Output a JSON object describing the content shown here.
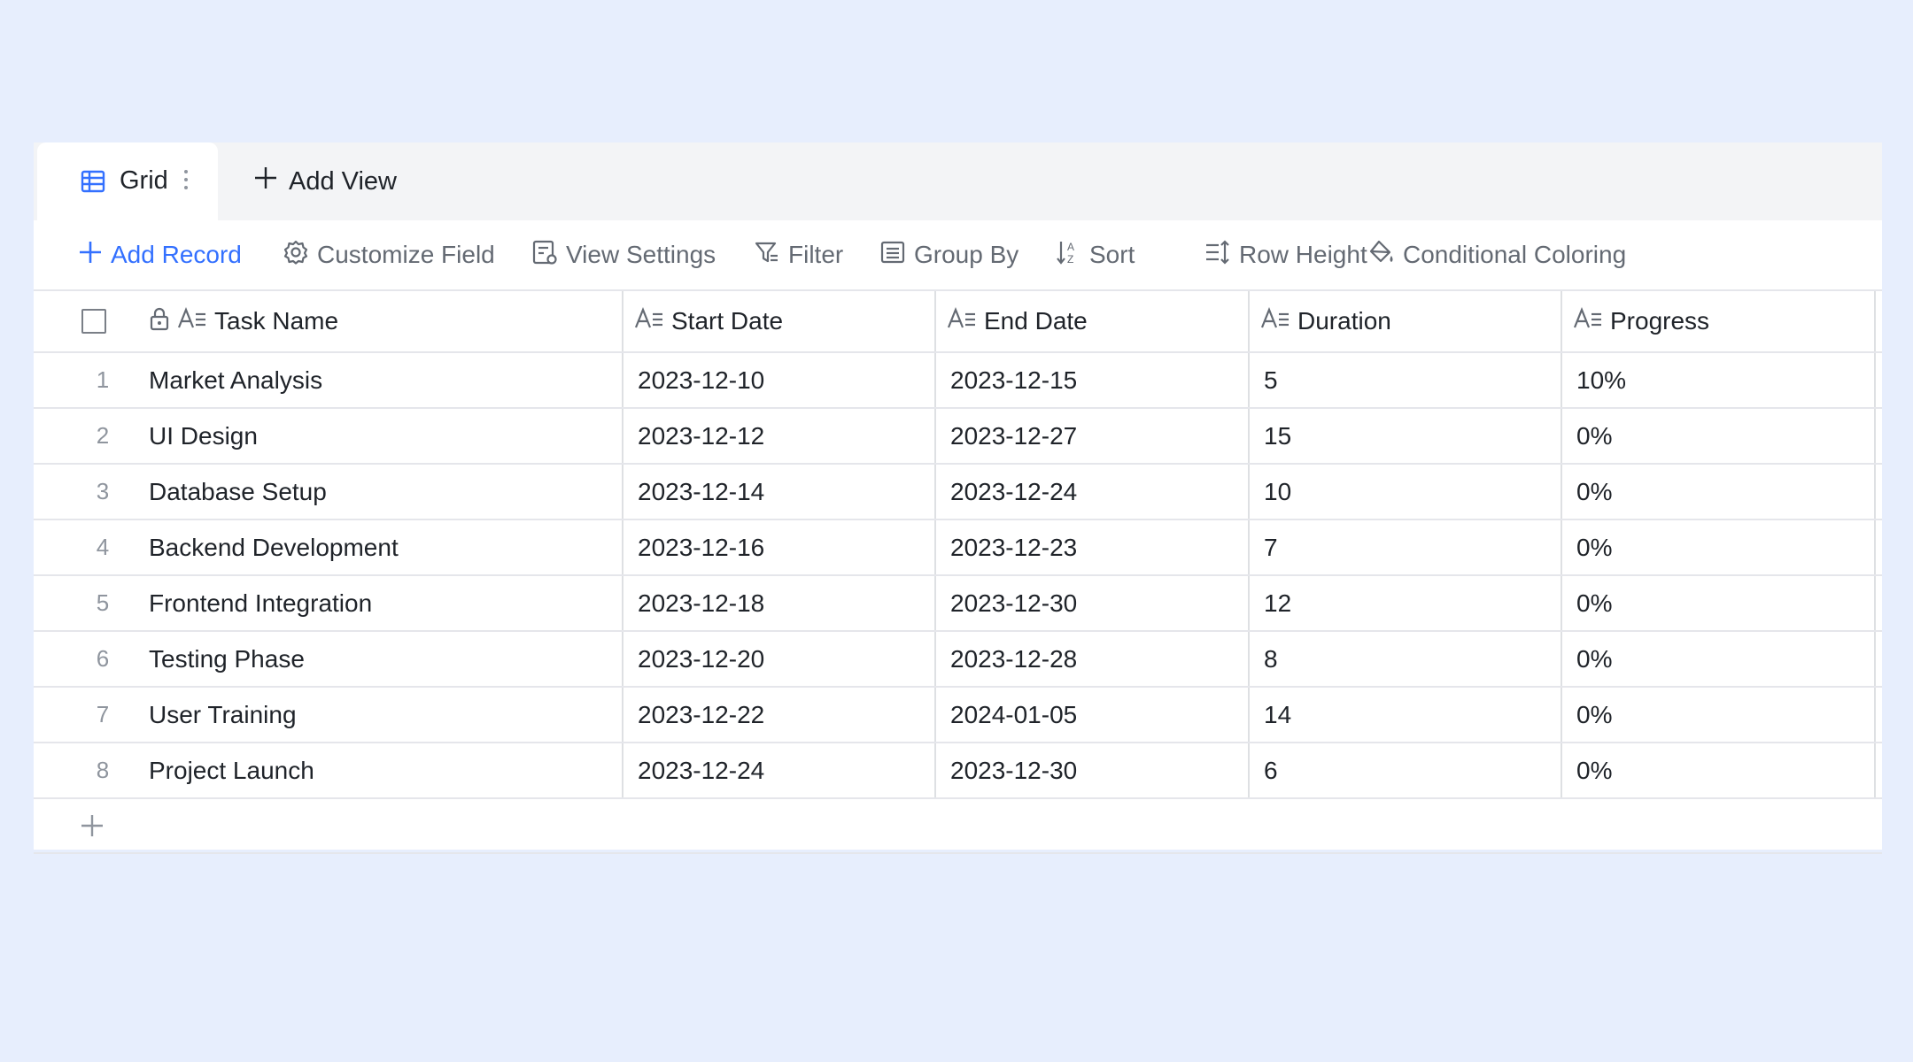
{
  "tabs": {
    "active_label": "Grid",
    "add_view_label": "Add View"
  },
  "toolbar": {
    "add_record": "Add Record",
    "customize_field": "Customize Field",
    "view_settings": "View Settings",
    "filter": "Filter",
    "group_by": "Group By",
    "sort": "Sort",
    "row_height": "Row Height",
    "conditional_coloring": "Conditional Coloring"
  },
  "table": {
    "columns": [
      "Task Name",
      "Start Date",
      "End Date",
      "Duration",
      "Progress"
    ],
    "rows": [
      {
        "num": "1",
        "task": "Market Analysis",
        "start": "2023-12-10",
        "end": "2023-12-15",
        "duration": "5",
        "progress": "10%"
      },
      {
        "num": "2",
        "task": "UI Design",
        "start": "2023-12-12",
        "end": "2023-12-27",
        "duration": "15",
        "progress": "0%"
      },
      {
        "num": "3",
        "task": "Database Setup",
        "start": "2023-12-14",
        "end": "2023-12-24",
        "duration": "10",
        "progress": "0%"
      },
      {
        "num": "4",
        "task": "Backend Development",
        "start": "2023-12-16",
        "end": "2023-12-23",
        "duration": "7",
        "progress": "0%"
      },
      {
        "num": "5",
        "task": "Frontend Integration",
        "start": "2023-12-18",
        "end": "2023-12-30",
        "duration": "12",
        "progress": "0%"
      },
      {
        "num": "6",
        "task": "Testing Phase",
        "start": "2023-12-20",
        "end": "2023-12-28",
        "duration": "8",
        "progress": "0%"
      },
      {
        "num": "7",
        "task": "User Training",
        "start": "2023-12-22",
        "end": "2024-01-05",
        "duration": "14",
        "progress": "0%"
      },
      {
        "num": "8",
        "task": "Project Launch",
        "start": "2023-12-24",
        "end": "2023-12-30",
        "duration": "6",
        "progress": "0%"
      }
    ]
  },
  "colors": {
    "accent": "#3370ff",
    "background": "#e7eefd",
    "muted_text": "#646a73"
  },
  "icons": {
    "grid_tab": "grid-table-icon",
    "more": "vertical-dots-icon",
    "add": "plus-icon",
    "customize": "gear-icon",
    "view_settings": "form-settings-icon",
    "filter": "filter-icon",
    "group_by": "list-group-icon",
    "sort": "sort-az-icon",
    "row_height": "row-height-icon",
    "coloring": "paint-bucket-icon",
    "lock": "lock-icon",
    "text_field": "text-field-icon"
  }
}
